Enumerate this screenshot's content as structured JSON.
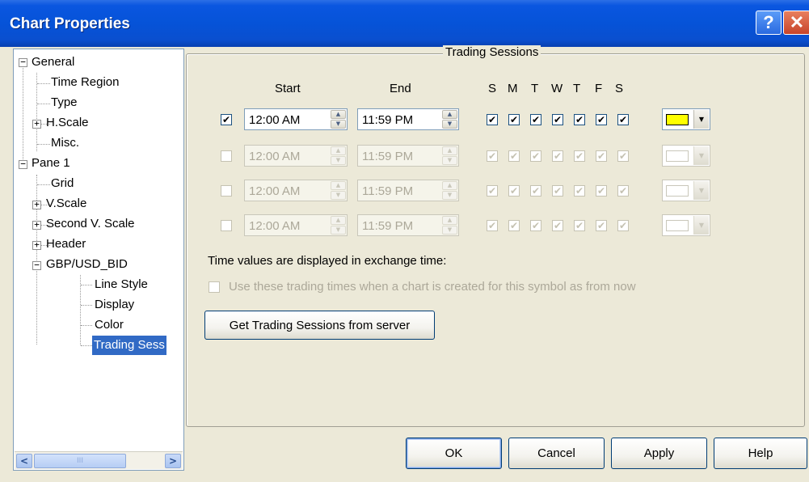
{
  "window": {
    "title": "Chart Properties",
    "help_glyph": "?",
    "close_glyph": "✕"
  },
  "tree": {
    "items": [
      {
        "label": "General",
        "expander": "−"
      },
      {
        "label": "Time Region"
      },
      {
        "label": "Type"
      },
      {
        "label": "H.Scale",
        "expander": "+"
      },
      {
        "label": "Misc."
      },
      {
        "label": "Pane 1",
        "expander": "−"
      },
      {
        "label": "Grid"
      },
      {
        "label": "V.Scale",
        "expander": "+"
      },
      {
        "label": "Second V. Scale",
        "expander": "+"
      },
      {
        "label": "Header",
        "expander": "+"
      },
      {
        "label": "GBP/USD_BID",
        "expander": "−"
      },
      {
        "label": "Line Style"
      },
      {
        "label": "Display"
      },
      {
        "label": "Color"
      },
      {
        "label": "Trading Sess",
        "selected": true
      }
    ],
    "scroll_left": "<",
    "scroll_right": ">",
    "scroll_thumb_grip": "III"
  },
  "sessions": {
    "group_title": "Trading Sessions",
    "start_header": "Start",
    "end_header": "End",
    "day_headers": [
      "S",
      "M",
      "T",
      "W",
      "T",
      "F",
      "S"
    ],
    "rows": [
      {
        "enabled": true,
        "checked": true,
        "start": "12:00 AM",
        "end": "11:59 PM",
        "days": [
          true,
          true,
          true,
          true,
          true,
          true,
          true
        ],
        "color": "#ffff00"
      },
      {
        "enabled": false,
        "checked": false,
        "start": "12:00 AM",
        "end": "11:59 PM",
        "days": [
          true,
          true,
          true,
          true,
          true,
          true,
          true
        ],
        "color": "#ffffff"
      },
      {
        "enabled": false,
        "checked": false,
        "start": "12:00 AM",
        "end": "11:59 PM",
        "days": [
          true,
          true,
          true,
          true,
          true,
          true,
          true
        ],
        "color": "#ffffff"
      },
      {
        "enabled": false,
        "checked": false,
        "start": "12:00 AM",
        "end": "11:59 PM",
        "days": [
          true,
          true,
          true,
          true,
          true,
          true,
          true
        ],
        "color": "#ffffff"
      }
    ],
    "check_glyph": "✔",
    "spin_up": "▲",
    "spin_down": "▼",
    "dropdown_glyph": "▼",
    "time_note": "Time values are displayed in exchange time:",
    "use_times_label": "Use these trading times when a chart is created for this symbol as from now",
    "use_times_checked": false,
    "get_sessions_button": "Get Trading Sessions from server"
  },
  "buttons": {
    "ok": "OK",
    "cancel": "Cancel",
    "apply": "Apply",
    "help": "Help"
  }
}
